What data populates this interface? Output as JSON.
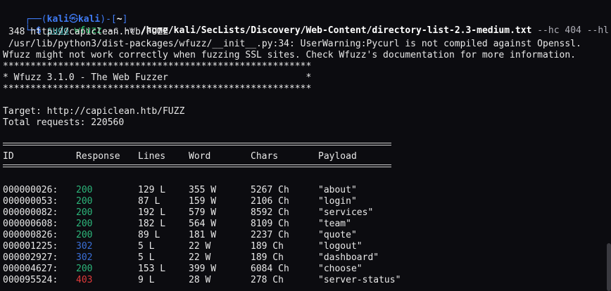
{
  "prompt": {
    "user": "kali",
    "host": "kali",
    "dir": "~",
    "sudo": "sudo",
    "tool": "wfuzz",
    "flag_c": "-c",
    "flag_w": "-w",
    "wordlist": "/home/kali/SecLists/Discovery/Web-Content/directory-list-2.3-medium.txt",
    "flag_hc": "--hc 404",
    "flag_hl": "--hl",
    "cont": "348 http://capiclean.htb/FUZZ"
  },
  "warning": [
    " /usr/lib/python3/dist-packages/wfuzz/__init__.py:34: UserWarning:Pycurl is not compiled against Openssl.",
    "Wfuzz might not work correctly when fuzzing SSL sites. Check Wfuzz's documentation for more information."
  ],
  "banner": {
    "stars": "********************************************************",
    "title": "* Wfuzz 3.1.0 - The Web Fuzzer                         *"
  },
  "target": "Target: http://capiclean.htb/FUZZ",
  "total": "Total requests: 220560",
  "table": {
    "headers": [
      "ID",
      "Response",
      "Lines",
      "Word",
      "Chars",
      "Payload"
    ],
    "rows": [
      {
        "id": "000000026:",
        "resp": "200",
        "lines": "129 L",
        "word": "355 W",
        "chars": "5267 Ch",
        "payload": "\"about\""
      },
      {
        "id": "000000053:",
        "resp": "200",
        "lines": "87 L",
        "word": "159 W",
        "chars": "2106 Ch",
        "payload": "\"login\""
      },
      {
        "id": "000000082:",
        "resp": "200",
        "lines": "192 L",
        "word": "579 W",
        "chars": "8592 Ch",
        "payload": "\"services\""
      },
      {
        "id": "000000608:",
        "resp": "200",
        "lines": "182 L",
        "word": "564 W",
        "chars": "8109 Ch",
        "payload": "\"team\""
      },
      {
        "id": "000000826:",
        "resp": "200",
        "lines": "89 L",
        "word": "181 W",
        "chars": "2237 Ch",
        "payload": "\"quote\""
      },
      {
        "id": "000001225:",
        "resp": "302",
        "lines": "5 L",
        "word": "22 W",
        "chars": "189 Ch",
        "payload": "\"logout\""
      },
      {
        "id": "000002927:",
        "resp": "302",
        "lines": "5 L",
        "word": "22 W",
        "chars": "189 Ch",
        "payload": "\"dashboard\""
      },
      {
        "id": "000004627:",
        "resp": "200",
        "lines": "153 L",
        "word": "399 W",
        "chars": "6084 Ch",
        "payload": "\"choose\""
      },
      {
        "id": "000095524:",
        "resp": "403",
        "lines": "9 L",
        "word": "28 W",
        "chars": "278 Ch",
        "payload": "\"server-status\""
      }
    ]
  },
  "colors": {
    "background": "#0c0c10",
    "status_200": "#2cb57a",
    "status_302": "#3a6fd8",
    "status_403": "#e03a3a",
    "prompt_frame": "#3f7bf5"
  }
}
